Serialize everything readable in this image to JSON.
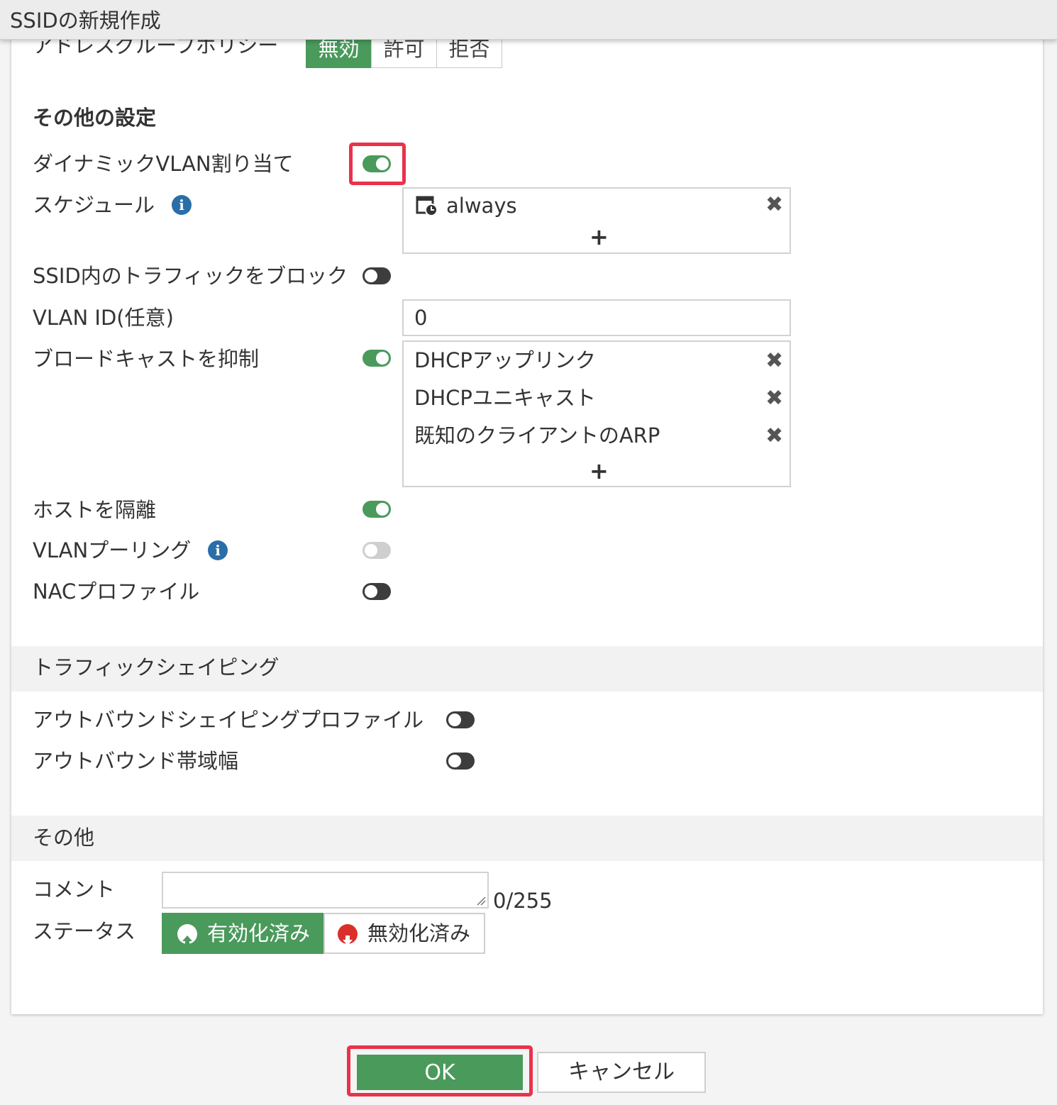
{
  "window": {
    "title": "SSIDの新規作成"
  },
  "address_group_policy": {
    "label": "アドレスグループポリシー",
    "options": [
      "無効",
      "許可",
      "拒否"
    ],
    "selected": "無効"
  },
  "other_settings": {
    "heading": "その他の設定",
    "dynamic_vlan": {
      "label": "ダイナミックVLAN割り当て",
      "enabled": true
    },
    "schedule": {
      "label": "スケジュール",
      "items": [
        "always"
      ],
      "add": "+"
    },
    "block_intra_ssid": {
      "label": "SSID内のトラフィックをブロック",
      "enabled": false
    },
    "vlan_id": {
      "label": "VLAN ID(任意)",
      "value": "0"
    },
    "broadcast_suppression": {
      "label": "ブロードキャストを抑制",
      "enabled": true,
      "items": [
        "DHCPアップリンク",
        "DHCPユニキャスト",
        "既知のクライアントのARP"
      ],
      "add": "+"
    },
    "isolate_hosts": {
      "label": "ホストを隔離",
      "enabled": true
    },
    "vlan_pooling": {
      "label": "VLANプーリング",
      "enabled": false,
      "disabled": true
    },
    "nac_profile": {
      "label": "NACプロファイル",
      "enabled": false
    }
  },
  "traffic_shaping": {
    "heading": "トラフィックシェイピング",
    "outbound_profile": {
      "label": "アウトバウンドシェイピングプロファイル",
      "enabled": false
    },
    "outbound_bandwidth": {
      "label": "アウトバウンド帯域幅",
      "enabled": false
    }
  },
  "misc": {
    "heading": "その他",
    "comment": {
      "label": "コメント",
      "value": "",
      "counter": "0/255"
    },
    "status": {
      "label": "ステータス",
      "enabled_label": "有効化済み",
      "disabled_label": "無効化済み",
      "selected": "有効化済み"
    }
  },
  "footer": {
    "ok": "OK",
    "cancel": "キャンセル"
  },
  "colors": {
    "accent": "#4a9a5c",
    "highlight": "#e8334a",
    "info": "#2a6ea8",
    "disable_icon": "#d9302c"
  }
}
